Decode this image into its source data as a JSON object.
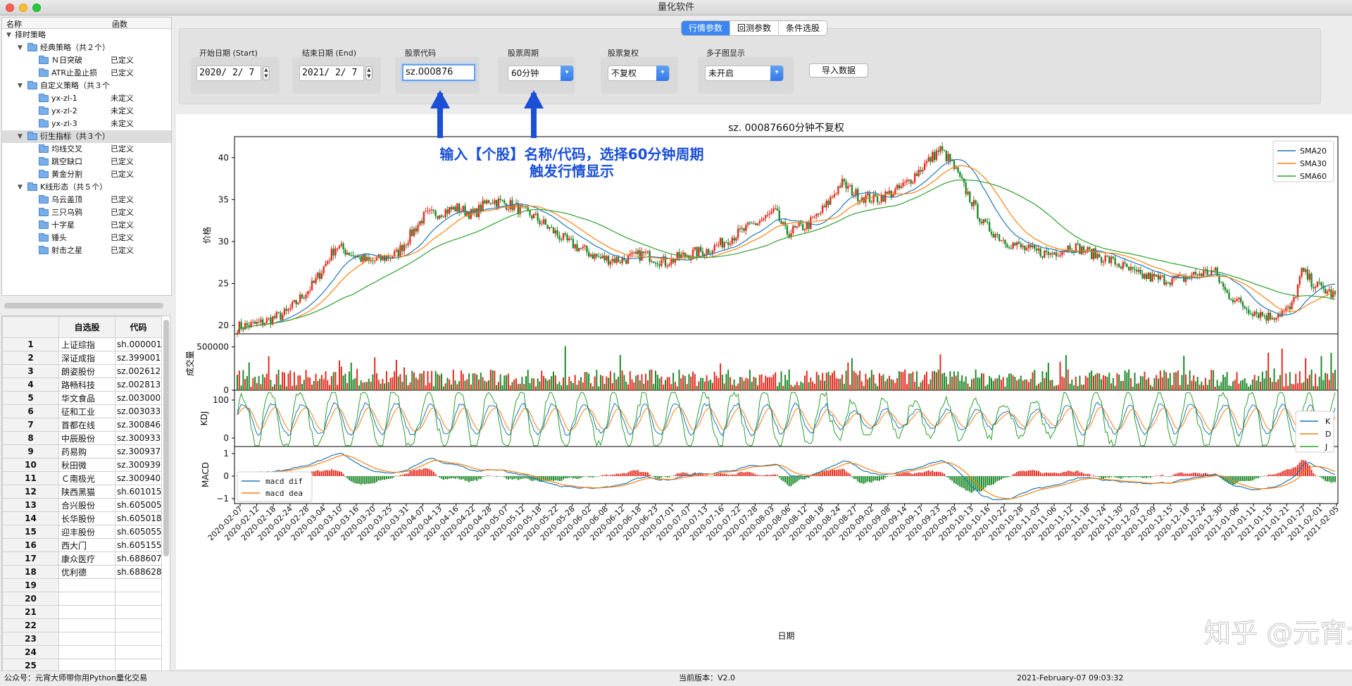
{
  "window": {
    "title": "量化软件"
  },
  "tree": {
    "header": {
      "col1": "名称",
      "col2": "函数"
    },
    "rows": [
      {
        "level": 0,
        "label": "择时策略",
        "status": "",
        "folder": false,
        "expand": true
      },
      {
        "level": 1,
        "label": "经典策略（共２个）",
        "status": "",
        "folder": true,
        "expand": true
      },
      {
        "level": 2,
        "label": "Ｎ日突破",
        "status": "已定义",
        "folder": true
      },
      {
        "level": 2,
        "label": "ATR止盈止损",
        "status": "已定义",
        "folder": true
      },
      {
        "level": 1,
        "label": "自定义策略（共３个",
        "status": "",
        "folder": true,
        "expand": true
      },
      {
        "level": 2,
        "label": "yx-zl-1",
        "status": "未定义",
        "folder": true
      },
      {
        "level": 2,
        "label": "yx-zl-2",
        "status": "未定义",
        "folder": true
      },
      {
        "level": 2,
        "label": "yx-zl-3",
        "status": "未定义",
        "folder": true
      },
      {
        "level": 1,
        "label": "衍生指标（共３个）",
        "status": "",
        "folder": true,
        "expand": true,
        "selected": true
      },
      {
        "level": 2,
        "label": "均线交叉",
        "status": "已定义",
        "folder": true
      },
      {
        "level": 2,
        "label": "跳空缺口",
        "status": "已定义",
        "folder": true
      },
      {
        "level": 2,
        "label": "黄金分割",
        "status": "已定义",
        "folder": true
      },
      {
        "level": 1,
        "label": "K线形态（共５个）",
        "status": "",
        "folder": true,
        "expand": true
      },
      {
        "level": 2,
        "label": "乌云盖顶",
        "status": "已定义",
        "folder": true
      },
      {
        "level": 2,
        "label": "三只乌鸦",
        "status": "已定义",
        "folder": true
      },
      {
        "level": 2,
        "label": "十字星",
        "status": "已定义",
        "folder": true
      },
      {
        "level": 2,
        "label": "锤头",
        "status": "已定义",
        "folder": true
      },
      {
        "level": 2,
        "label": "射击之星",
        "status": "已定义",
        "folder": true
      }
    ]
  },
  "stock_table": {
    "headers": {
      "name": "自选股",
      "code": "代码"
    },
    "rows": [
      {
        "i": "1",
        "name": "上证综指",
        "code": "sh.000001"
      },
      {
        "i": "2",
        "name": "深证成指",
        "code": "sz.399001"
      },
      {
        "i": "3",
        "name": "朗姿股份",
        "code": "sz.002612"
      },
      {
        "i": "4",
        "name": "路畅科技",
        "code": "sz.002813"
      },
      {
        "i": "5",
        "name": "华文食品",
        "code": "sz.003000"
      },
      {
        "i": "6",
        "name": "征和工业",
        "code": "sz.003033"
      },
      {
        "i": "7",
        "name": "首都在线",
        "code": "sz.300846"
      },
      {
        "i": "8",
        "name": "中辰股份",
        "code": "sz.300933"
      },
      {
        "i": "9",
        "name": "药易购",
        "code": "sz.300937"
      },
      {
        "i": "10",
        "name": "秋田微",
        "code": "sz.300939"
      },
      {
        "i": "11",
        "name": "Ｃ南极光",
        "code": "sz.300940"
      },
      {
        "i": "12",
        "name": "陕西黑猫",
        "code": "sh.601015"
      },
      {
        "i": "13",
        "name": "合兴股份",
        "code": "sh.605005"
      },
      {
        "i": "14",
        "name": "长华股份",
        "code": "sh.605018"
      },
      {
        "i": "15",
        "name": "迎丰股份",
        "code": "sh.605055"
      },
      {
        "i": "16",
        "name": "西大门",
        "code": "sh.605155"
      },
      {
        "i": "17",
        "name": "康众医疗",
        "code": "sh.688607"
      },
      {
        "i": "18",
        "name": "优利德",
        "code": "sh.688628"
      },
      {
        "i": "19",
        "name": "",
        "code": ""
      },
      {
        "i": "20",
        "name": "",
        "code": ""
      },
      {
        "i": "21",
        "name": "",
        "code": ""
      },
      {
        "i": "22",
        "name": "",
        "code": ""
      },
      {
        "i": "23",
        "name": "",
        "code": ""
      },
      {
        "i": "24",
        "name": "",
        "code": ""
      },
      {
        "i": "25",
        "name": "",
        "code": ""
      }
    ]
  },
  "tabs": [
    {
      "label": "行情参数",
      "active": true
    },
    {
      "label": "回测参数",
      "active": false
    },
    {
      "label": "条件选股",
      "active": false
    }
  ],
  "params": {
    "start_label": "开始日期 (Start)",
    "start_value": "2020/  2/  7",
    "end_label": "结束日期 (End)",
    "end_value": "2021/  2/  7",
    "code_label": "股票代码",
    "code_value": "sz.000876",
    "period_label": "股票周期",
    "period_value": "60分钟",
    "adjust_label": "股票复权",
    "adjust_value": "不复权",
    "multi_label": "多子图显示",
    "multi_value": "未开启",
    "import_button": "导入数据",
    "stepper_up": "▲",
    "stepper_down": "▼",
    "dropdown_icon": "▾"
  },
  "annotation": {
    "line1": "输入【个股】名称/代码，选择60分钟周期",
    "line2": "触发行情显示",
    "color": "#1a4fd6"
  },
  "chart_data": {
    "type": "line",
    "title": "sz. 00087660分钟不复权",
    "xlabel": "日期",
    "x_ticks": [
      "2020-02-07",
      "2020-02-12",
      "2020-02-18",
      "2020-02-24",
      "2020-02-28",
      "2020-03-04",
      "2020-03-10",
      "2020-03-16",
      "2020-03-20",
      "2020-03-25",
      "2020-03-31",
      "2020-04-07",
      "2020-04-13",
      "2020-04-16",
      "2020-04-22",
      "2020-04-28",
      "2020-05-07",
      "2020-05-12",
      "2020-05-18",
      "2020-05-22",
      "2020-05-28",
      "2020-06-02",
      "2020-06-08",
      "2020-06-12",
      "2020-06-18",
      "2020-06-23",
      "2020-07-01",
      "2020-07-07",
      "2020-07-13",
      "2020-07-16",
      "2020-07-22",
      "2020-07-28",
      "2020-08-03",
      "2020-08-06",
      "2020-08-12",
      "2020-08-18",
      "2020-08-24",
      "2020-08-27",
      "2020-09-02",
      "2020-09-08",
      "2020-09-14",
      "2020-09-17",
      "2020-09-23",
      "2020-09-29",
      "2020-10-13",
      "2020-10-16",
      "2020-10-22",
      "2020-10-28",
      "2020-11-03",
      "2020-11-06",
      "2020-11-12",
      "2020-11-18",
      "2020-11-24",
      "2020-11-30",
      "2020-12-03",
      "2020-12-09",
      "2020-12-15",
      "2020-12-18",
      "2020-12-24",
      "2020-12-30",
      "2021-01-06",
      "2021-01-11",
      "2021-01-15",
      "2021-01-21",
      "2021-01-27",
      "2021-02-01",
      "2021-02-05"
    ],
    "price": {
      "ylabel": "价格",
      "ylim": [
        19,
        42.5
      ],
      "yticks": [
        "20",
        "25",
        "30",
        "35",
        "40"
      ],
      "close_anchors": [
        [
          0,
          19.8
        ],
        [
          0.02,
          20.2
        ],
        [
          0.045,
          21.5
        ],
        [
          0.07,
          25
        ],
        [
          0.09,
          29.5
        ],
        [
          0.1,
          28.8
        ],
        [
          0.12,
          27.5
        ],
        [
          0.145,
          28.5
        ],
        [
          0.17,
          33
        ],
        [
          0.2,
          34
        ],
        [
          0.215,
          33.2
        ],
        [
          0.23,
          35
        ],
        [
          0.25,
          34.3
        ],
        [
          0.27,
          33
        ],
        [
          0.3,
          30
        ],
        [
          0.33,
          28
        ],
        [
          0.35,
          27.8
        ],
        [
          0.37,
          28.5
        ],
        [
          0.39,
          27.5
        ],
        [
          0.41,
          28.5
        ],
        [
          0.43,
          29
        ],
        [
          0.45,
          30.5
        ],
        [
          0.47,
          32
        ],
        [
          0.49,
          33.5
        ],
        [
          0.5,
          31
        ],
        [
          0.52,
          32
        ],
        [
          0.535,
          34
        ],
        [
          0.55,
          37
        ],
        [
          0.565,
          35.5
        ],
        [
          0.58,
          35
        ],
        [
          0.6,
          36
        ],
        [
          0.61,
          37
        ],
        [
          0.625,
          39
        ],
        [
          0.64,
          41
        ],
        [
          0.65,
          39.5
        ],
        [
          0.66,
          37
        ],
        [
          0.68,
          32
        ],
        [
          0.7,
          30
        ],
        [
          0.72,
          29
        ],
        [
          0.74,
          28.5
        ],
        [
          0.76,
          29.5
        ],
        [
          0.78,
          28.5
        ],
        [
          0.8,
          27.5
        ],
        [
          0.82,
          26
        ],
        [
          0.84,
          25.5
        ],
        [
          0.86,
          25.5
        ],
        [
          0.87,
          26
        ],
        [
          0.89,
          26.5
        ],
        [
          0.9,
          24
        ],
        [
          0.92,
          22
        ],
        [
          0.94,
          21
        ],
        [
          0.96,
          22
        ],
        [
          0.97,
          26.5
        ],
        [
          0.98,
          25
        ],
        [
          1,
          23.5
        ]
      ],
      "series": [
        {
          "name": "SMA20",
          "color": "#1f77b4"
        },
        {
          "name": "SMA30",
          "color": "#ff7f0e"
        },
        {
          "name": "SMA60",
          "color": "#2ca02c"
        }
      ]
    },
    "volume": {
      "ylabel": "成交量",
      "yticks": [
        "0",
        "500000"
      ],
      "ymax": 650000
    },
    "kdj": {
      "ylabel": "KDJ",
      "yticks": [
        "0",
        "100"
      ],
      "series": [
        {
          "name": "K",
          "color": "#1f77b4"
        },
        {
          "name": "D",
          "color": "#ff7f0e"
        },
        {
          "name": "J",
          "color": "#2ca02c"
        }
      ]
    },
    "macd": {
      "ylabel": "MACD",
      "yticks": [
        "1",
        "0",
        "−1"
      ],
      "series": [
        {
          "name": "macd dif",
          "color": "#1f77b4"
        },
        {
          "name": "macd dea",
          "color": "#ff7f0e"
        }
      ]
    },
    "up_color": "#e32b1f",
    "down_color": "#1e8a2a"
  },
  "status": {
    "left": "公众号：元宵大师带你用Python量化交易",
    "version": "当前版本：V2.0",
    "time": "2021-February-07 09:03:32"
  },
  "watermark": "知乎 @元宵大师"
}
